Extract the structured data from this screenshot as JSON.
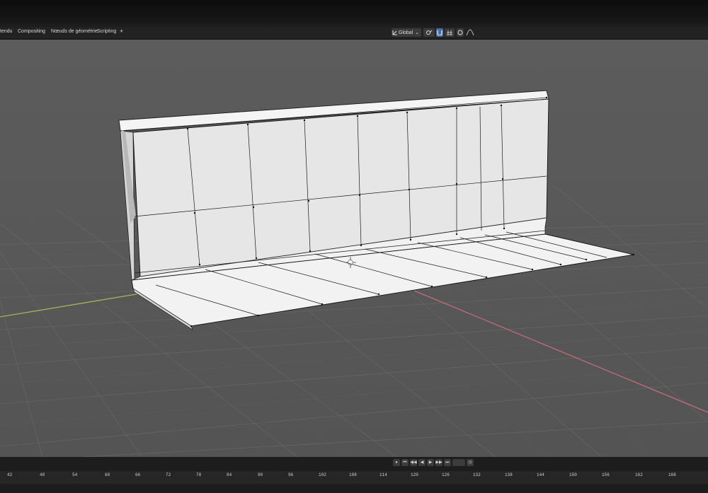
{
  "menu_tabs": [
    {
      "id": "rendu",
      "label": "tendu"
    },
    {
      "id": "compositing",
      "label": "Compositing"
    },
    {
      "id": "noeuds",
      "label": "Nœuds de géométrie"
    },
    {
      "id": "scripting",
      "label": "Scripting"
    }
  ],
  "add_tab_label": "+",
  "header": {
    "transform_orientation": "Global",
    "dropdown_arrow": "⌄"
  },
  "icons": {
    "orientation": "axes-icon",
    "pivot": "pivot-icon",
    "snap": "magnet-icon",
    "proportional": "circle-icon"
  },
  "colors": {
    "viewport_bg": "#595959",
    "grid_line": "#6b6b6b",
    "x_axis": "#c26a7a",
    "y_axis": "#9bb85a",
    "mesh_face": "#e9e9e9",
    "mesh_wire": "#111111"
  },
  "timeline": {
    "buttons": [
      "⏮",
      "◀◀",
      "◀",
      "▶",
      "▶▶",
      "⏭"
    ],
    "frames": [
      "42",
      "48",
      "54",
      "60",
      "66",
      "72",
      "78",
      "84",
      "90",
      "96",
      "102",
      "108",
      "114",
      "120",
      "126",
      "132",
      "138",
      "144",
      "150",
      "156",
      "162",
      "168"
    ]
  }
}
